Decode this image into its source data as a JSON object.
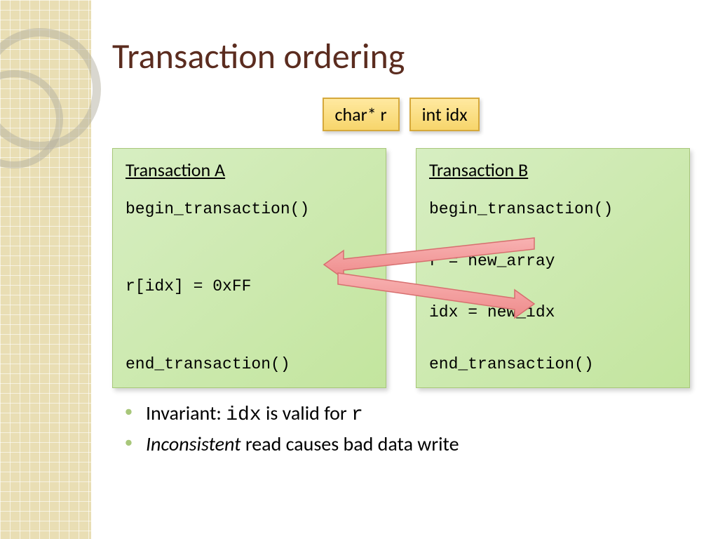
{
  "title": "Transaction ordering",
  "pills": {
    "left": "char* r",
    "right": "int idx"
  },
  "panelA": {
    "title": "Transaction A",
    "code": "begin_transaction()\n\n\nr[idx] = 0xFF\n\n\nend_transaction()"
  },
  "panelB": {
    "title": "Transaction B",
    "code": "begin_transaction()\n\nr = new_array\n\nidx = new_idx\n\nend_transaction()"
  },
  "bullet1": {
    "prefix": "Invariant: ",
    "code1": "idx",
    "mid": " is valid for ",
    "code2": "r"
  },
  "bullet2": {
    "em": "Inconsistent",
    "rest": " read causes bad data write"
  }
}
